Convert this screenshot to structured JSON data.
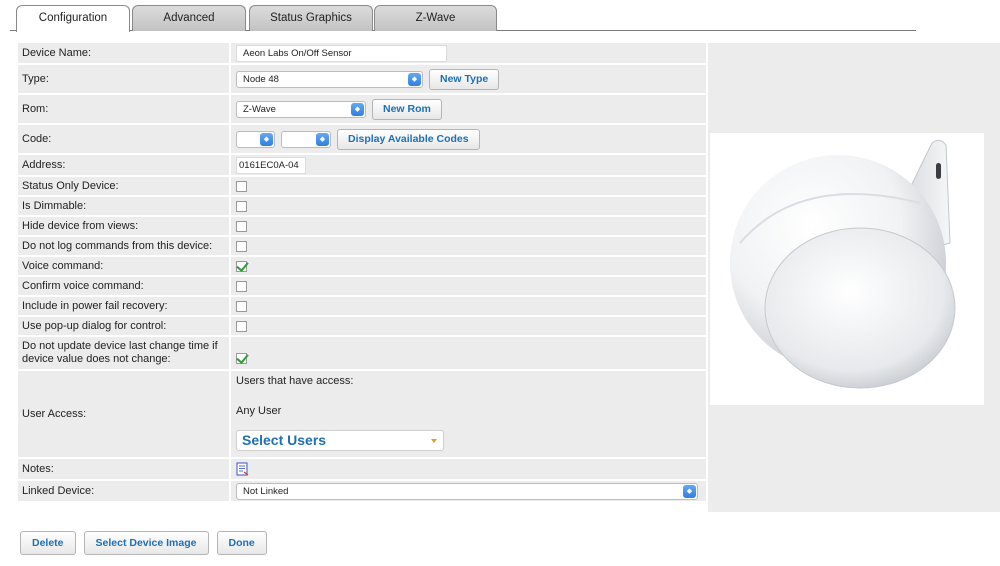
{
  "tabs": [
    {
      "label": "Configuration",
      "active": true
    },
    {
      "label": "Advanced",
      "active": false
    },
    {
      "label": "Status Graphics",
      "active": false
    },
    {
      "label": "Z-Wave",
      "active": false
    }
  ],
  "form": {
    "device_name": {
      "label": "Device Name:",
      "value": "Aeon Labs On/Off Sensor"
    },
    "type": {
      "label": "Type:",
      "value": "Node 48",
      "button": "New Type"
    },
    "rom": {
      "label": "Rom:",
      "value": "Z-Wave",
      "button": "New Rom"
    },
    "code": {
      "label": "Code:",
      "value1": "",
      "value2": "",
      "button": "Display Available Codes"
    },
    "address": {
      "label": "Address:",
      "value": "0161EC0A-04"
    },
    "checkboxes": [
      {
        "label": "Status Only Device:",
        "checked": false
      },
      {
        "label": "Is Dimmable:",
        "checked": false
      },
      {
        "label": "Hide device from views:",
        "checked": false
      },
      {
        "label": "Do not log commands from this device:",
        "checked": false
      },
      {
        "label": "Voice command:",
        "checked": true
      },
      {
        "label": "Confirm voice command:",
        "checked": false
      },
      {
        "label": "Include in power fail recovery:",
        "checked": false
      },
      {
        "label": "Use pop-up dialog for control:",
        "checked": false
      }
    ],
    "no_update": {
      "label": "Do not update device last change time if device value does not change:",
      "checked": true
    },
    "user_access": {
      "label": "User Access:",
      "title": "Users that have access:",
      "users": "Any User",
      "select_label": "Select Users"
    },
    "notes": {
      "label": "Notes:",
      "icon": "notes-icon"
    },
    "linked_device": {
      "label": "Linked Device:",
      "value": "Not Linked"
    }
  },
  "buttons": {
    "delete": "Delete",
    "select_image": "Select Device Image",
    "done": "Done"
  },
  "colors": {
    "row_bg": "#ececec",
    "link_blue": "#1f6fb5",
    "select_arrow": "#2f7fe0",
    "check_green": "#2f9e34"
  }
}
